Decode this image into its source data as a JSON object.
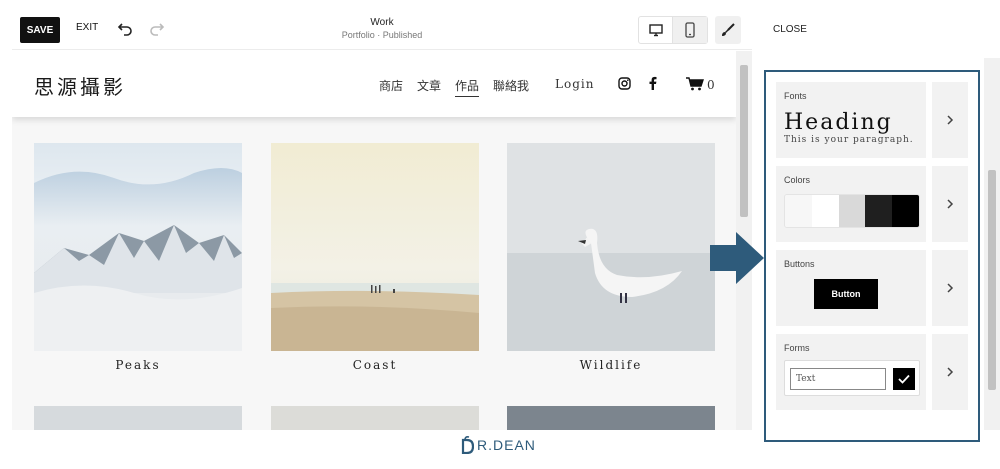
{
  "toolbar": {
    "save_label": "SAVE",
    "exit_label": "EXIT",
    "page_title": "Work",
    "page_status": "Portfolio · Published",
    "undo_icon": "undo-icon",
    "redo_icon": "redo-icon",
    "desktop_icon": "desktop-icon",
    "mobile_icon": "mobile-icon",
    "design_icon": "paintbrush-icon"
  },
  "site": {
    "logo": "思源攝影",
    "nav": [
      "商店",
      "文章",
      "作品",
      "聯絡我"
    ],
    "active_nav": "作品",
    "login": "Login",
    "cart_count": "0",
    "gallery": [
      {
        "label": "Peaks"
      },
      {
        "label": "Coast"
      },
      {
        "label": "Wildlife"
      }
    ]
  },
  "panel": {
    "close_label": "CLOSE",
    "fonts": {
      "label": "Fonts",
      "heading": "Heading",
      "paragraph": "This is your paragraph."
    },
    "colors": {
      "label": "Colors",
      "swatches": [
        "#f7f7f7",
        "#ffffff",
        "#d9d9d9",
        "#1f1f1f",
        "#000000"
      ]
    },
    "buttons": {
      "label": "Buttons",
      "button_label": "Button"
    },
    "forms": {
      "label": "Forms",
      "input_placeholder": "Text"
    }
  },
  "brand": {
    "text": "R.DEAN"
  },
  "colors": {
    "accent": "#2e5b7b",
    "dark": "#111111"
  }
}
